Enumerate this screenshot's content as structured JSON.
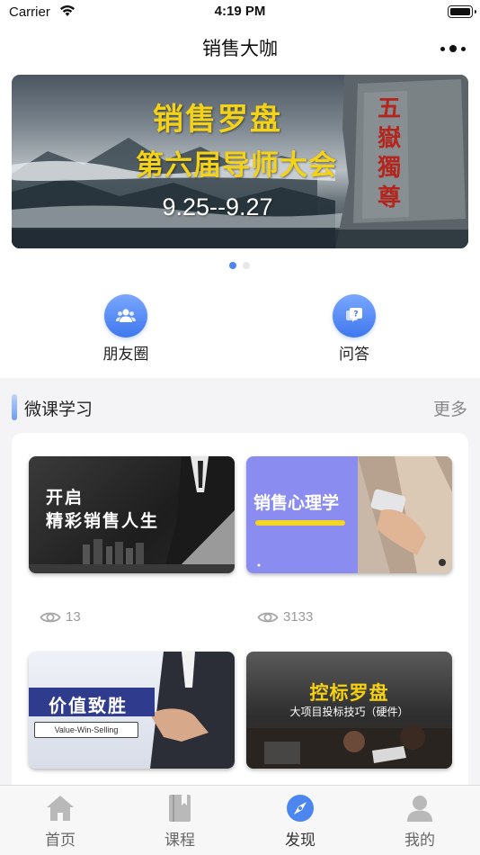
{
  "status_bar": {
    "carrier": "Carrier",
    "time": "4:19 PM"
  },
  "nav": {
    "title": "销售大咖"
  },
  "banner": {
    "line1": "销售罗盘",
    "line2": "第六届导师大会",
    "line3": "9.25--9.27",
    "carving": "五嶽獨尊"
  },
  "carousel": {
    "active_index": 0,
    "count": 2
  },
  "quick_entries": [
    {
      "label": "朋友圈",
      "icon": "people-icon"
    },
    {
      "label": "问答",
      "icon": "qa-icon"
    }
  ],
  "section": {
    "title": "微课学习",
    "more": "更多"
  },
  "courses": [
    {
      "line1": "开启",
      "line2": "精彩销售人生",
      "views": "13"
    },
    {
      "line1": "销售心理学",
      "views": "3133"
    },
    {
      "line1": "价值致胜",
      "line2": "Value-Win-Selling"
    },
    {
      "line1": "控标罗盘",
      "line2": "大项目投标技巧（硬件）"
    }
  ],
  "tab_bar": {
    "tabs": [
      {
        "label": "首页",
        "icon": "home-icon"
      },
      {
        "label": "课程",
        "icon": "book-icon"
      },
      {
        "label": "发现",
        "icon": "compass-icon",
        "active": true
      },
      {
        "label": "我的",
        "icon": "user-icon"
      }
    ]
  },
  "colors": {
    "accent": "#4c86f0",
    "banner_text": "#f3d218",
    "tab_inactive": "#b9b9b9"
  }
}
